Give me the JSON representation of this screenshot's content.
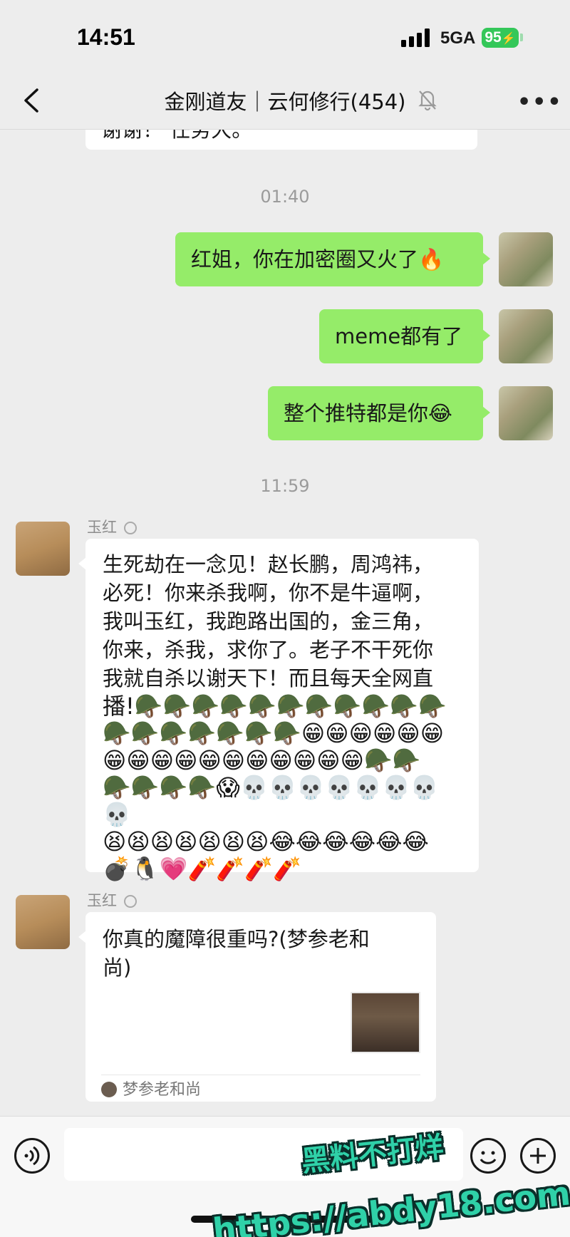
{
  "status_bar": {
    "time": "14:51",
    "network": "5GA",
    "battery": "95"
  },
  "header": {
    "title": "金刚道友｜云何修行(454)",
    "back_icon": "chevron-left-icon",
    "mute_icon": "bell-slash-icon",
    "more_label": "•••"
  },
  "messages": {
    "top_partial": "谢谢！ 任务大。",
    "timestamp_1": "01:40",
    "self_1": "红姐，你在加密圈又火了🔥",
    "self_2": "meme都有了",
    "self_3": "整个推特都是你😂",
    "timestamp_2": "11:59",
    "other_1": {
      "sender": "玉红",
      "lines": [
        "生死劫在一念见！赵长鹏，周鸿祎，",
        "必死！你来杀我啊，你不是牛逼啊，",
        "我叫玉红，我跑路出国的，金三角，",
        "你来，杀我，求你了。老子不干死你",
        "我就自杀以谢天下！而且每天全网直",
        "播!🪖🪖🪖🪖🪖🪖🪖🪖🪖🪖🪖",
        "🪖🪖🪖🪖🪖🪖🪖😁😁😁😁😁😁",
        "😁😁😁😁😁😁😁😁😁😁😁🪖🪖",
        "🪖🪖🪖🪖😱💀💀💀💀💀💀💀💀",
        "😫😫😫😫😫😫😫😂😂😂😂😂😂",
        "💣🐧💗🧨🧨🧨🧨"
      ]
    },
    "other_2": {
      "sender": "玉红",
      "card_title_1": "你真的魔障很重吗?(梦参老和",
      "card_title_2": "尚)",
      "card_source": "梦参老和尚"
    }
  },
  "watermark": {
    "line1": "黑料不打烊",
    "line2": "https://abdy18.com"
  },
  "colors": {
    "self_bubble": "#95ec69",
    "other_bubble": "#ffffff",
    "background": "#ededed"
  }
}
